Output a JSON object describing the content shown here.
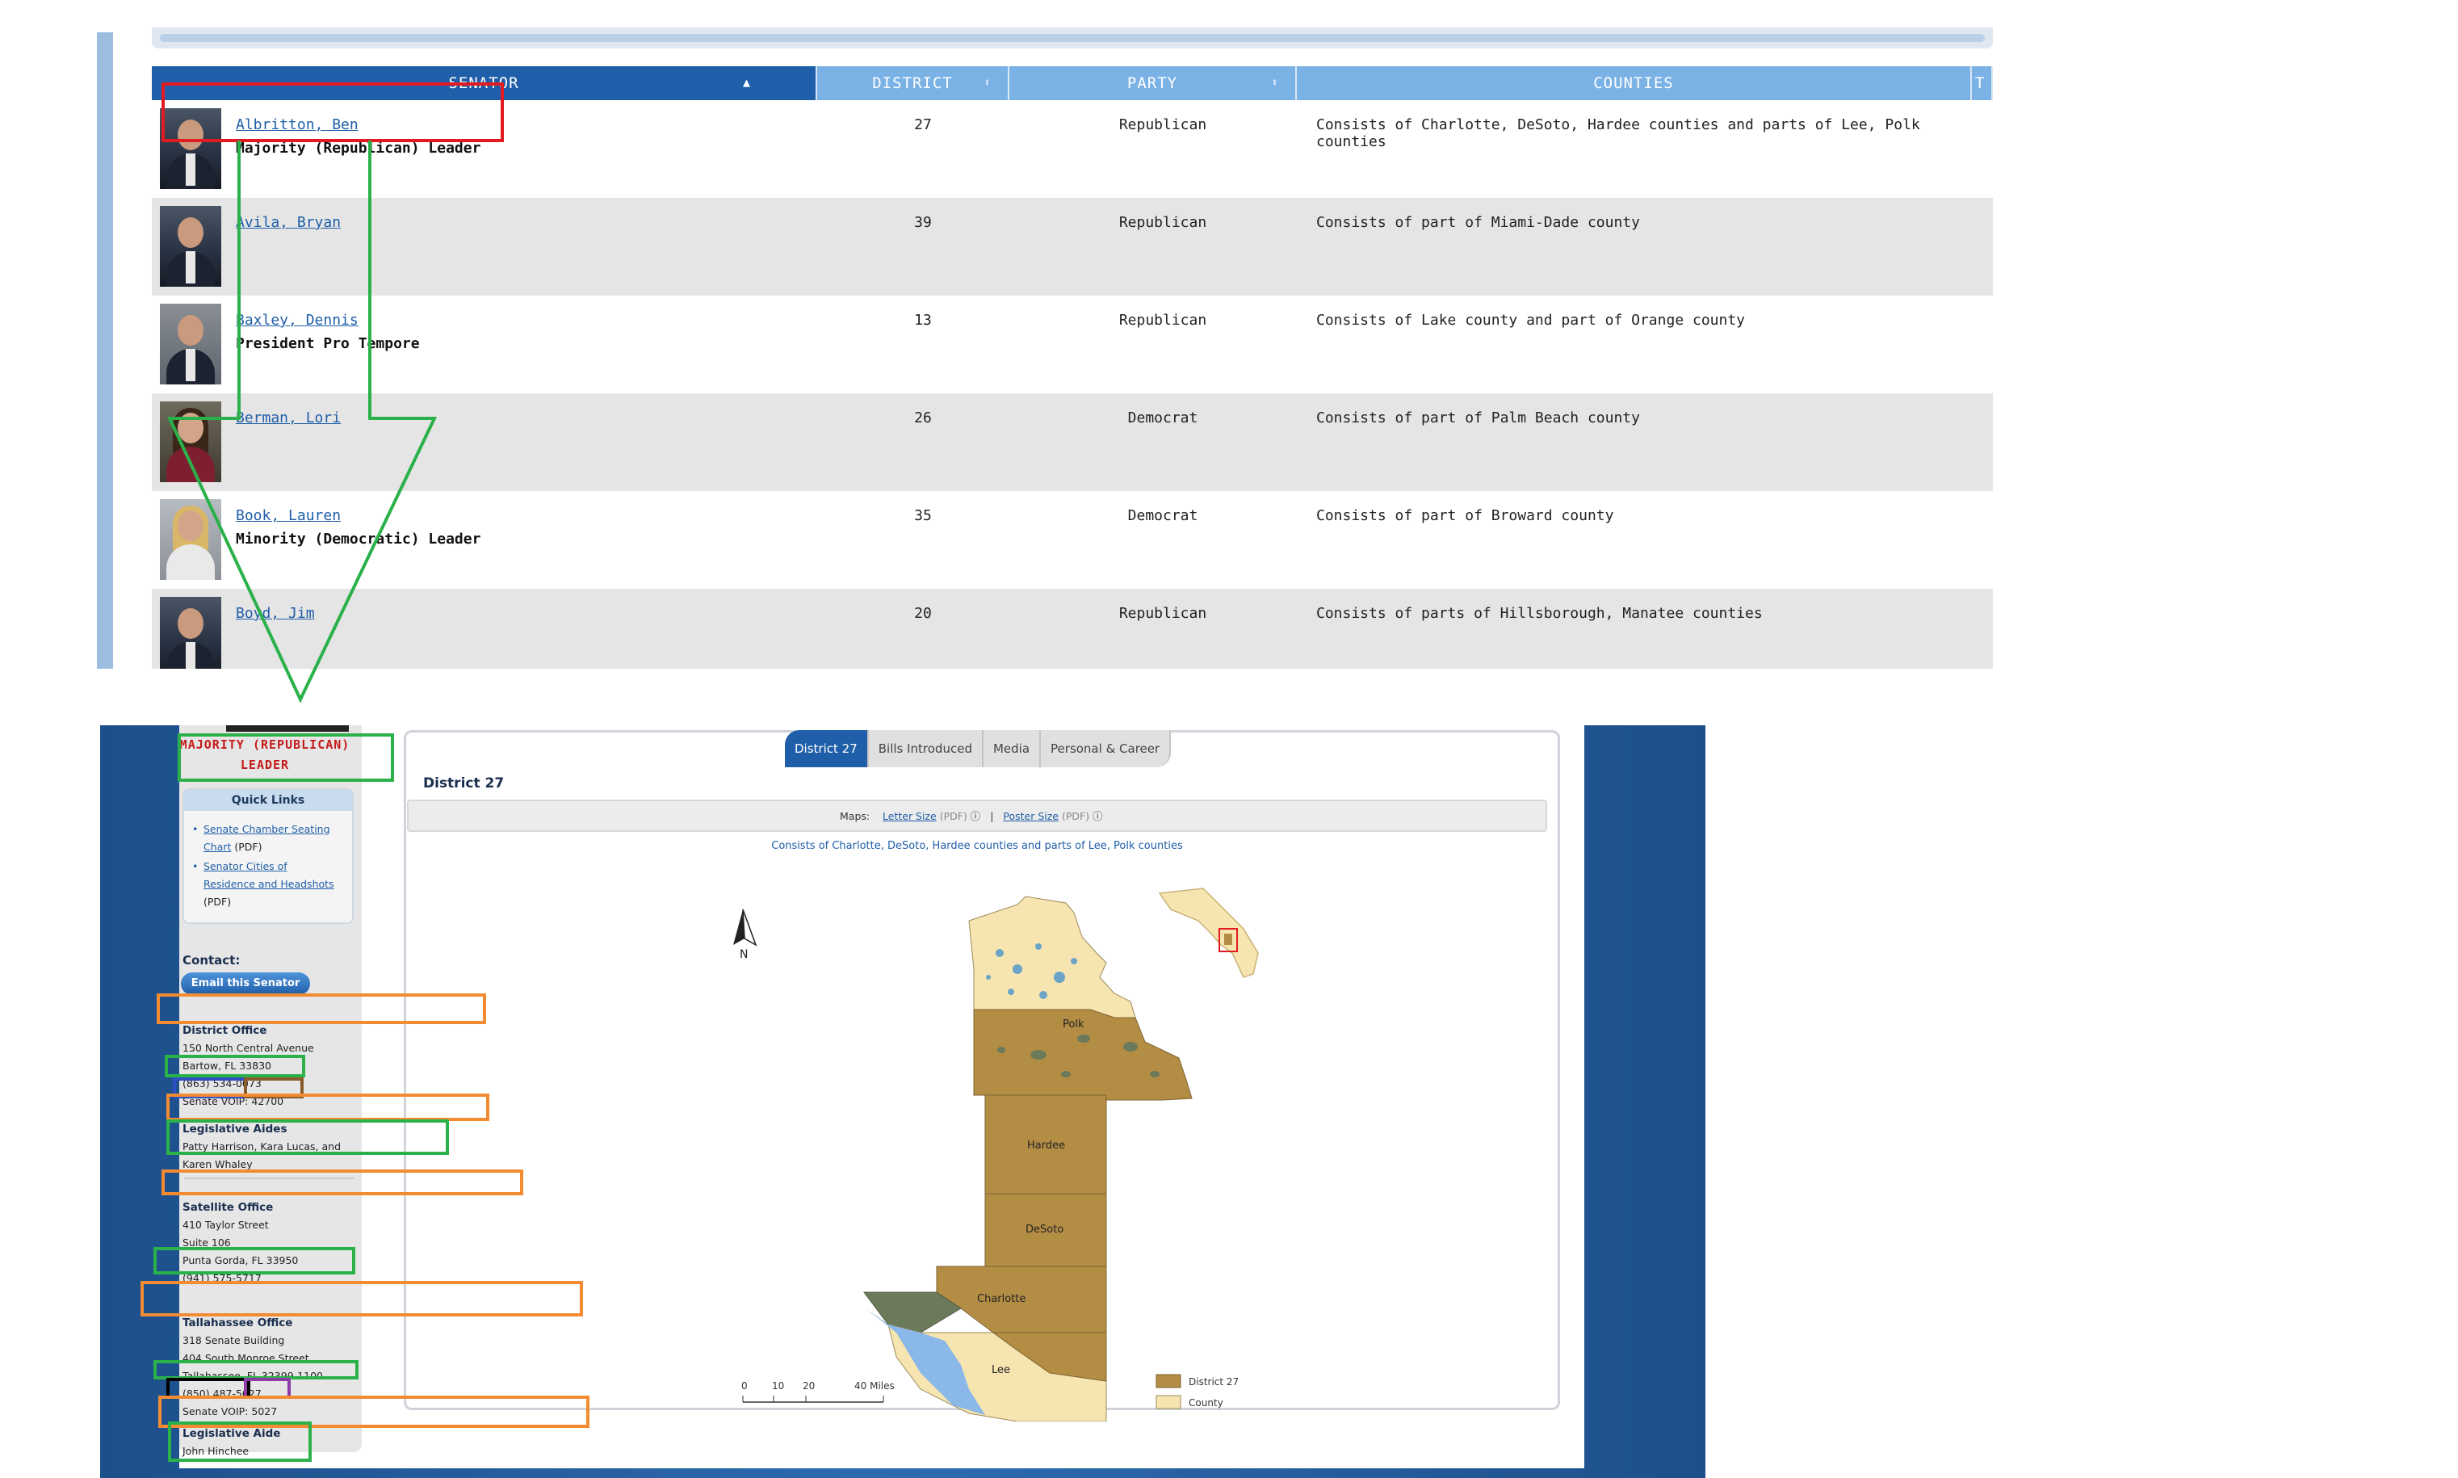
{
  "roster": {
    "columns": {
      "senator": "SENATOR",
      "district": "DISTRICT",
      "party": "PARTY",
      "counties": "COUNTIES",
      "extra": "T"
    },
    "rows": [
      {
        "name": "Albritton, Ben",
        "title": "Majority (Republican) Leader",
        "district": "27",
        "party": "Republican",
        "counties": "Consists of Charlotte, DeSoto, Hardee counties and parts of Lee, Polk counties"
      },
      {
        "name": "Avila, Bryan",
        "title": "",
        "district": "39",
        "party": "Republican",
        "counties": "Consists of part of Miami-Dade county"
      },
      {
        "name": "Baxley, Dennis",
        "title": "President Pro Tempore",
        "district": "13",
        "party": "Republican",
        "counties": "Consists of Lake county and part of Orange county"
      },
      {
        "name": "Berman, Lori",
        "title": "",
        "district": "26",
        "party": "Democrat",
        "counties": "Consists of part of Palm Beach county"
      },
      {
        "name": "Book, Lauren",
        "title": "Minority (Democratic) Leader",
        "district": "35",
        "party": "Democrat",
        "counties": "Consists of part of Broward county"
      },
      {
        "name": "Boyd, Jim",
        "title": "",
        "district": "20",
        "party": "Republican",
        "counties": "Consists of parts of Hillsborough, Manatee counties"
      }
    ]
  },
  "senator_page": {
    "title_line1": "MAJORITY (REPUBLICAN)",
    "title_line2": "LEADER",
    "quick_links": {
      "heading": "Quick Links",
      "link1_a": "Senate Chamber Seating",
      "link1_b": "Chart",
      "link1_suffix": "(PDF)",
      "link2_a": "Senator Cities of",
      "link2_b": "Residence and Headshots",
      "link2_suffix": "(PDF)"
    },
    "contact_label": "Contact:",
    "email_button": "Email this Senator",
    "district_office": {
      "heading": "District Office",
      "line1": "150 North Central Avenue",
      "line2": "Bartow, FL 33830",
      "phone": "(863) 534-0073",
      "voip_label": "Senate VOIP:",
      "voip_number": "42700"
    },
    "legislative_aides": {
      "heading": "Legislative Aides",
      "line1": "Patty Harrison, Kara Lucas, and",
      "line2": "Karen Whaley"
    },
    "satellite_office": {
      "heading": "Satellite Office",
      "line1": "410 Taylor Street",
      "line2": "Suite 106",
      "line3": "Punta Gorda, FL 33950",
      "phone": "(941) 575-5717"
    },
    "tallahassee_office": {
      "heading": "Tallahassee Office",
      "line1": "318 Senate Building",
      "line2": "404 South Monroe Street",
      "line3": "Tallahassee, FL 32399-1100",
      "phone": "(850) 487-5027",
      "voip_label": "Senate VOIP:",
      "voip_number": "5027"
    },
    "legislative_aide": {
      "heading": "Legislative Aide",
      "line1": "John Hinchee"
    },
    "tabs": [
      "District 27",
      "Bills Introduced",
      "Media",
      "Personal & Career"
    ],
    "district_heading": "District 27",
    "maps": {
      "label": "Maps:",
      "letter": "Letter Size",
      "poster": "Poster Size",
      "pdf": "(PDF)",
      "sep": "|"
    },
    "map_caption": "Consists of Charlotte, DeSoto, Hardee counties and parts of Lee, Polk counties",
    "map": {
      "north": "N",
      "counties": [
        "Polk",
        "Hardee",
        "DeSoto",
        "Charlotte",
        "Lee"
      ],
      "scale": [
        "0",
        "10",
        "20",
        "40 Miles"
      ],
      "legend": [
        "District 27",
        "County"
      ]
    }
  },
  "colors": {
    "header_dark": "#1f5ea8",
    "header_light": "#7ab2e6",
    "district_fill": "#b48d45",
    "county_fill": "#f6e5b0",
    "water": "#8ab8e8",
    "red_box": "#e21b23",
    "green_box": "#2bb14a",
    "orange_box": "#f38b32",
    "blue_box": "#2f4fc7",
    "brown_box": "#8b5a2b",
    "purple_box": "#8e3aa8",
    "black_box": "#000000"
  }
}
